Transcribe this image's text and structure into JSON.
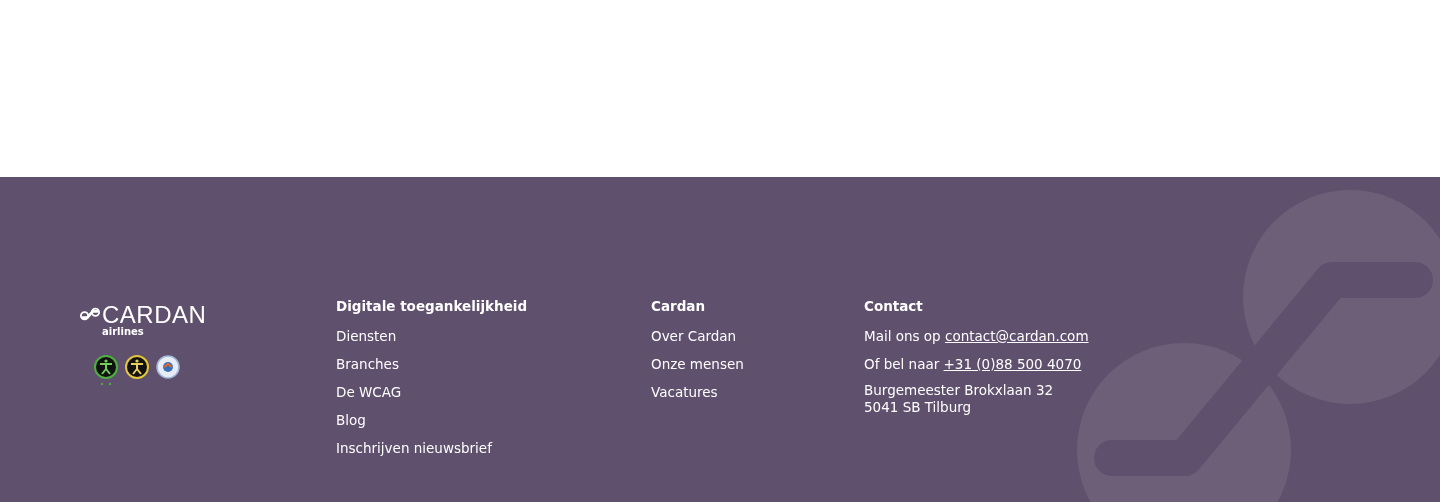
{
  "brand": {
    "name": "CARDAN",
    "sub": "airlines"
  },
  "columns": [
    {
      "title": "Digitale toegankelijkheid",
      "links": [
        "Diensten",
        "Branches",
        "De WCAG",
        "Blog",
        "Inschrijven nieuwsbrief"
      ]
    },
    {
      "title": "Cardan",
      "links": [
        "Over Cardan",
        "Onze mensen",
        "Vacatures"
      ]
    }
  ],
  "contact": {
    "title": "Contact",
    "lines": [
      {
        "text": "Mail ons op",
        "link": "contact@cardan.com"
      },
      {
        "text": "Of bel naar",
        "link": "+31 (0)88 500 4070"
      }
    ],
    "address": [
      "Burgemeester Brokxlaan 32",
      "5041 SB Tilburg"
    ]
  }
}
